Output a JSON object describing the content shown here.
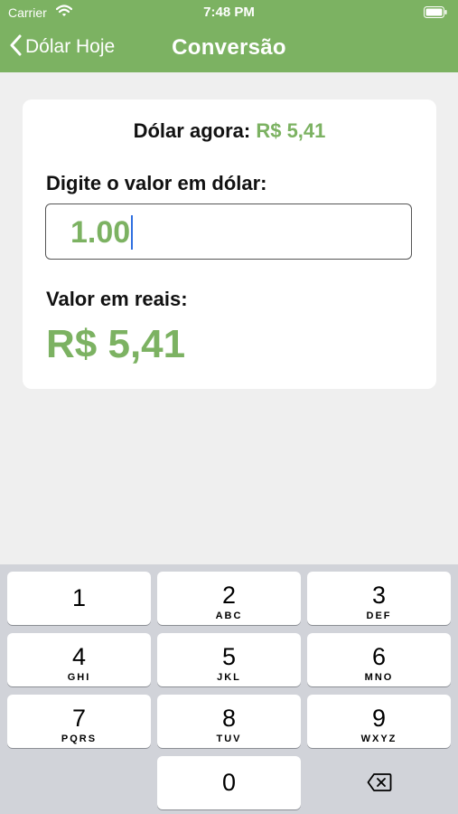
{
  "status_bar": {
    "carrier": "Carrier",
    "time": "7:48 PM"
  },
  "nav": {
    "back_label": "Dólar Hoje",
    "title": "Conversão"
  },
  "converter": {
    "rate_label": "Dólar agora:",
    "rate_value": "R$ 5,41",
    "input_label": "Digite o valor em dólar:",
    "input_value": "1.00",
    "result_label": "Valor em reais:",
    "result_value": "R$ 5,41"
  },
  "keyboard": {
    "keys": [
      {
        "digit": "1",
        "letters": ""
      },
      {
        "digit": "2",
        "letters": "ABC"
      },
      {
        "digit": "3",
        "letters": "DEF"
      },
      {
        "digit": "4",
        "letters": "GHI"
      },
      {
        "digit": "5",
        "letters": "JKL"
      },
      {
        "digit": "6",
        "letters": "MNO"
      },
      {
        "digit": "7",
        "letters": "PQRS"
      },
      {
        "digit": "8",
        "letters": "TUV"
      },
      {
        "digit": "9",
        "letters": "WXYZ"
      },
      {
        "digit": "0",
        "letters": ""
      }
    ]
  },
  "colors": {
    "accent": "#7cb262",
    "caret": "#2f6fe0",
    "keyboard_bg": "#d1d3d9"
  }
}
